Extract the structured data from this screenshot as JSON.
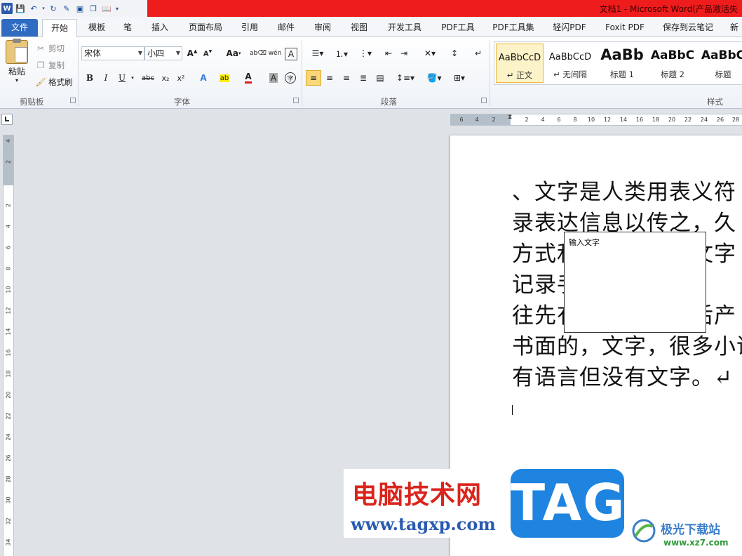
{
  "app": {
    "window_title": "文档1 - Microsoft Word(产品激活失",
    "accent_color": "#2f6bc1",
    "title_strip_color": "#ee1c1c"
  },
  "quick_access": {
    "icons": [
      "word-logo-icon",
      "save-icon",
      "undo-icon",
      "redo-icon",
      "edit-icon",
      "print-preview-icon",
      "copy-icon",
      "read-mode-icon",
      "customize-icon"
    ]
  },
  "tabs": [
    "文件",
    "开始",
    "模板",
    "笔",
    "插入",
    "页面布局",
    "引用",
    "邮件",
    "审阅",
    "视图",
    "开发工具",
    "PDF工具",
    "PDF工具集",
    "轻闪PDF",
    "Foxit PDF",
    "保存到云笔记",
    "新"
  ],
  "ribbon": {
    "clipboard": {
      "paste": "粘贴",
      "cut": "剪切",
      "copy": "复制",
      "format_painter": "格式刷",
      "group": "剪贴板"
    },
    "font": {
      "font_name": "宋体",
      "font_size": "小四",
      "change_case": "Aa",
      "group": "字体",
      "buttons": [
        "B",
        "I",
        "U",
        "abc",
        "x₂",
        "x²"
      ]
    },
    "paragraph": {
      "group": "段落"
    },
    "styles": {
      "group": "样式",
      "items": [
        {
          "preview": "AaBbCcD",
          "name": "↵ 正文"
        },
        {
          "preview": "AaBbCcD",
          "name": "↵ 无间隔"
        },
        {
          "preview": "AaBb",
          "name": "标题 1"
        },
        {
          "preview": "AaBbC",
          "name": "标题 2"
        },
        {
          "preview": "AaBbC",
          "name": "标题"
        }
      ]
    }
  },
  "rulers": {
    "horizontal_ticks": [
      "6",
      "4",
      "2",
      "2",
      "4",
      "6",
      "8",
      "10",
      "12",
      "14",
      "16",
      "18",
      "20",
      "22",
      "24",
      "26",
      "28"
    ],
    "vertical_ticks": [
      "4",
      "2",
      "2",
      "4",
      "6",
      "8",
      "10",
      "12",
      "14",
      "16",
      "18",
      "20",
      "22",
      "24",
      "26",
      "28",
      "30",
      "32",
      "34"
    ]
  },
  "document": {
    "lines": [
      "、文字是人类用表义符",
      "录表达信息以传之，久",
      "方式和工具。现代文字",
      "记录手段。人",
      "往先有口头的语言后产",
      "书面的，文字，很多小语",
      "有语言但没有文字。↵"
    ],
    "textbox_text": "输入文字"
  },
  "watermark": {
    "site_name": "电脑技术网",
    "site_url": "www.tagxp.com",
    "tag_text": "TAG",
    "brand_name": "极光下载站",
    "brand_url": "www.xz7.com"
  }
}
